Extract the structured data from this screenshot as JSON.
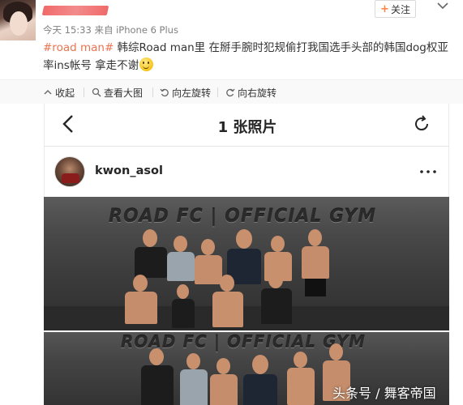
{
  "post": {
    "meta": "今天 15:33 来自 iPhone 6 Plus",
    "follow_label": "关注",
    "topic_tag": "#road man#",
    "text": " 韩综Road man里 在掰手腕时犯规偷打我国选手头部的韩国dog权亚率ins帐号 拿走不谢",
    "emoji": "smile-emoji"
  },
  "media_tools": [
    {
      "label": "收起",
      "icon": "collapse-icon"
    },
    {
      "label": "查看大图",
      "icon": "zoom-icon"
    },
    {
      "label": "向左旋转",
      "icon": "rotate-left-icon"
    },
    {
      "label": "向右旋转",
      "icon": "rotate-right-icon"
    }
  ],
  "instagram": {
    "title": "1 张照片",
    "username": "kwon_asol",
    "wall_text_1": "ROAD FC | OFFICIAL GYM",
    "wall_text_2": "ROAD FC | OFFICIAL GYM"
  },
  "watermark": "头条号 / 舞客帝国",
  "colors": {
    "tag": "#eb7350",
    "follow_plus": "#ff8140",
    "redaction": "#f06a6a"
  }
}
